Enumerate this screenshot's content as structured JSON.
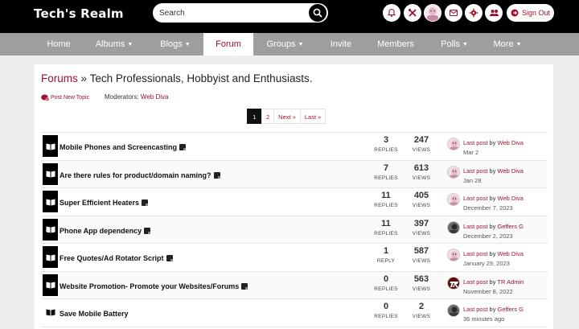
{
  "brand": "Tech's Realm",
  "search": {
    "placeholder": "Search"
  },
  "header_icons": [
    "bell-icon",
    "tools-icon",
    "user-avatar",
    "mail-icon",
    "gear-icon",
    "users-icon"
  ],
  "signout_label": "Sign Out",
  "nav": [
    {
      "label": "Home",
      "caret": false,
      "active": false
    },
    {
      "label": "Albums",
      "caret": true,
      "active": false
    },
    {
      "label": "Blogs",
      "caret": true,
      "active": false
    },
    {
      "label": "Forum",
      "caret": false,
      "active": true
    },
    {
      "label": "Groups",
      "caret": true,
      "active": false
    },
    {
      "label": "Invite",
      "caret": false,
      "active": false
    },
    {
      "label": "Members",
      "caret": false,
      "active": false
    },
    {
      "label": "Polls",
      "caret": true,
      "active": false
    },
    {
      "label": "More",
      "caret": true,
      "active": false
    }
  ],
  "breadcrumb": {
    "root": "Forums",
    "separator": "»",
    "current": "Tech Professionals, Hobbyist and Enthusiasts."
  },
  "post_new_topic": "Post New Topic",
  "moderators": {
    "label": "Moderators:",
    "name": "Web Diva"
  },
  "pagination": {
    "current": "1",
    "next_page": "2",
    "next": "Next »",
    "last": "Last »"
  },
  "topics": [
    {
      "title": "Mobile Phones and Screencasting",
      "replies": "3",
      "replies_label": "REPLIES",
      "views": "247",
      "views_label": "VIEWS",
      "last_post_label": "Last post",
      "by": "by",
      "user": "Web Diva",
      "date": "Mar 2",
      "avatar": "pink",
      "note_icon": true,
      "book_style": "boxed"
    },
    {
      "title": "Are there rules for product/domain naming?",
      "replies": "7",
      "replies_label": "REPLIES",
      "views": "613",
      "views_label": "VIEWS",
      "last_post_label": "Last post",
      "by": "by",
      "user": "Web Diva",
      "date": "Jan 28",
      "avatar": "pink",
      "note_icon": true,
      "book_style": "boxed"
    },
    {
      "title": "Super Efficient Heaters",
      "replies": "11",
      "replies_label": "REPLIES",
      "views": "405",
      "views_label": "VIEWS",
      "last_post_label": "Last post",
      "by": "by",
      "user": "Web Diva",
      "date": "December 7, 2023",
      "avatar": "pink",
      "note_icon": true,
      "book_style": "boxed"
    },
    {
      "title": "Phone App dependency",
      "replies": "11",
      "replies_label": "REPLIES",
      "views": "397",
      "views_label": "VIEWS",
      "last_post_label": "Last post",
      "by": "by",
      "user": "Geffers G",
      "date": "December 2, 2023",
      "avatar": "dark",
      "note_icon": true,
      "book_style": "boxed"
    },
    {
      "title": "Free Quotes/Ad Rotator Script",
      "replies": "1",
      "replies_label": "REPLY",
      "views": "587",
      "views_label": "VIEWS",
      "last_post_label": "Last post",
      "by": "by",
      "user": "Web Diva",
      "date": "January 29, 2023",
      "avatar": "pink",
      "note_icon": true,
      "book_style": "boxed"
    },
    {
      "title": "Website Promotion- Promote your Websites/Forums",
      "replies": "0",
      "replies_label": "REPLIES",
      "views": "563",
      "views_label": "VIEWS",
      "last_post_label": "Last post",
      "by": "by",
      "user": "TR Admin",
      "date": "November 8, 2022",
      "avatar": "red",
      "note_icon": true,
      "book_style": "boxed"
    },
    {
      "title": "Save Mobile Battery",
      "replies": "0",
      "replies_label": "REPLIES",
      "views": "2",
      "views_label": "VIEWS",
      "last_post_label": "Last post",
      "by": "by",
      "user": "Geffers G",
      "date": "36 minutes ago",
      "avatar": "dark",
      "note_icon": false,
      "book_style": "plain"
    }
  ],
  "colors": {
    "accent": "#a0102e",
    "topbar": "#000000",
    "nav": "#9e9e9e"
  }
}
